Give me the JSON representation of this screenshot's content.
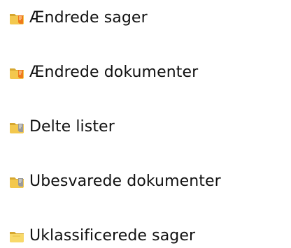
{
  "folders": [
    {
      "label": "Ændrede sager",
      "icon": "folder-changed-icon"
    },
    {
      "label": "Ændrede dokumenter",
      "icon": "folder-changed-icon"
    },
    {
      "label": "Delte lister",
      "icon": "folder-shared-icon"
    },
    {
      "label": "Ubesvarede dokumenter",
      "icon": "folder-shared-icon"
    },
    {
      "label": "Uklassificerede sager",
      "icon": "folder-plain-icon"
    }
  ],
  "colors": {
    "folder_base": "#f3c84e",
    "folder_front": "#f8d96a",
    "folder_shadow": "#d6a730",
    "accent_orange": "#ef7a1a",
    "accent_gray": "#9a9a9a",
    "text": "#111111"
  }
}
